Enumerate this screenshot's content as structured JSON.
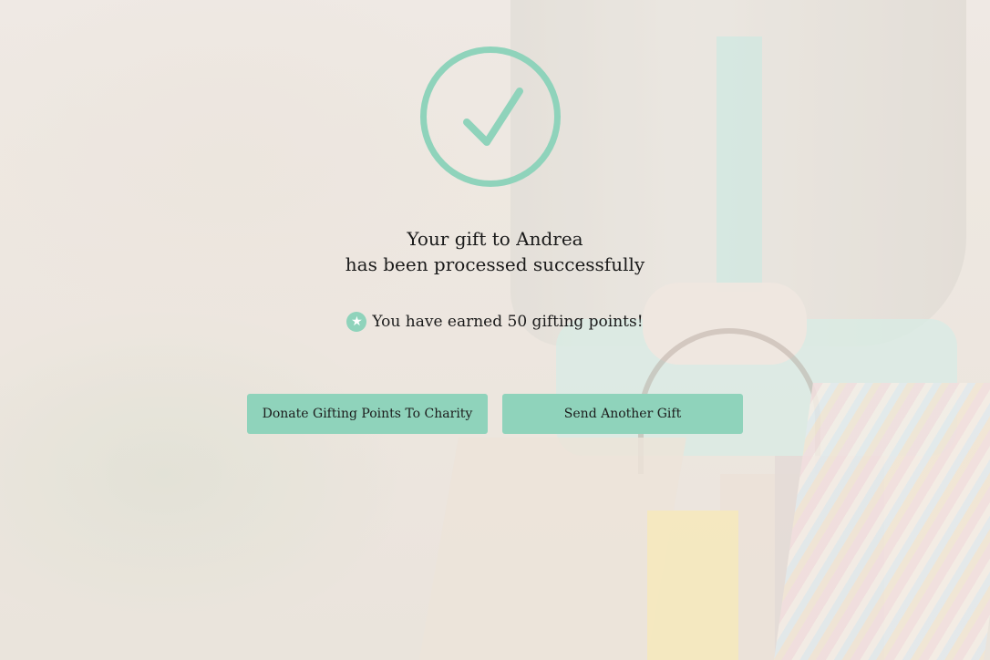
{
  "confirmation": {
    "line1": "Your gift to Andrea",
    "line2": "has been processed successfully"
  },
  "points": {
    "icon": "star-icon",
    "text": "You have earned 50 gifting points!"
  },
  "actions": {
    "donate_label": "Donate Gifting Points To Charity",
    "send_label": "Send Another Gift"
  },
  "colors": {
    "accent": "#8fd3bb",
    "text": "#1a1a1a"
  },
  "success_icon": "check-circle-icon"
}
